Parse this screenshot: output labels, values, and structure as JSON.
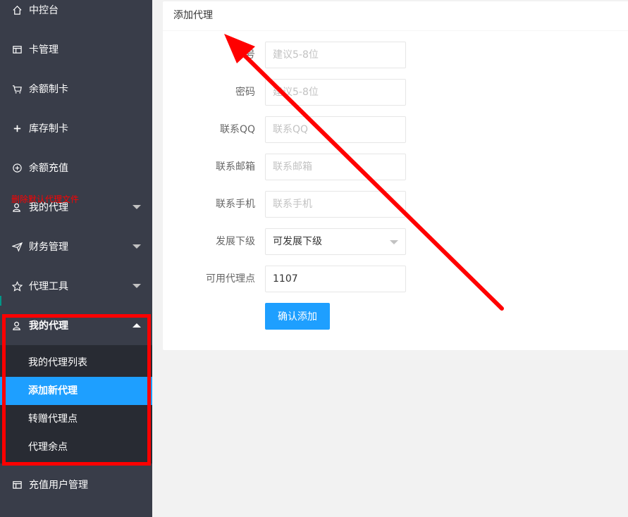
{
  "sidebar": {
    "items": [
      {
        "label": "中控台",
        "icon": "home-icon"
      },
      {
        "label": "卡管理",
        "icon": "card-icon"
      },
      {
        "label": "余额制卡",
        "icon": "cart-icon"
      },
      {
        "label": "库存制卡",
        "icon": "plus-icon"
      },
      {
        "label": "余额充值",
        "icon": "plus-circle-icon"
      },
      {
        "label": "我的代理",
        "icon": "user-icon"
      },
      {
        "label": "财务管理",
        "icon": "send-icon"
      },
      {
        "label": "代理工具",
        "icon": "star-icon"
      },
      {
        "label": "我的代理",
        "icon": "user-icon"
      },
      {
        "label": "充值用户管理",
        "icon": "card-icon"
      }
    ],
    "red_note": "删除默认代理文件",
    "sub_items": [
      {
        "label": "我的代理列表"
      },
      {
        "label": "添加新代理"
      },
      {
        "label": "转赠代理点"
      },
      {
        "label": "代理余点"
      }
    ]
  },
  "card": {
    "title": "添加代理",
    "fields": [
      {
        "label": "账号",
        "placeholder": "建议5-8位",
        "value": ""
      },
      {
        "label": "密码",
        "placeholder": "建议5-8位",
        "value": ""
      },
      {
        "label": "联系QQ",
        "placeholder": "联系QQ",
        "value": ""
      },
      {
        "label": "联系邮箱",
        "placeholder": "联系邮箱",
        "value": ""
      },
      {
        "label": "联系手机",
        "placeholder": "联系手机",
        "value": ""
      }
    ],
    "select": {
      "label": "发展下级",
      "value": "可发展下级"
    },
    "points": {
      "label": "可用代理点",
      "value": "1107"
    },
    "submit_label": "确认添加"
  },
  "colors": {
    "sidebar_bg": "#393d49",
    "submenu_bg": "#282b33",
    "accent": "#1e9fff",
    "annotation": "#ff0000"
  }
}
